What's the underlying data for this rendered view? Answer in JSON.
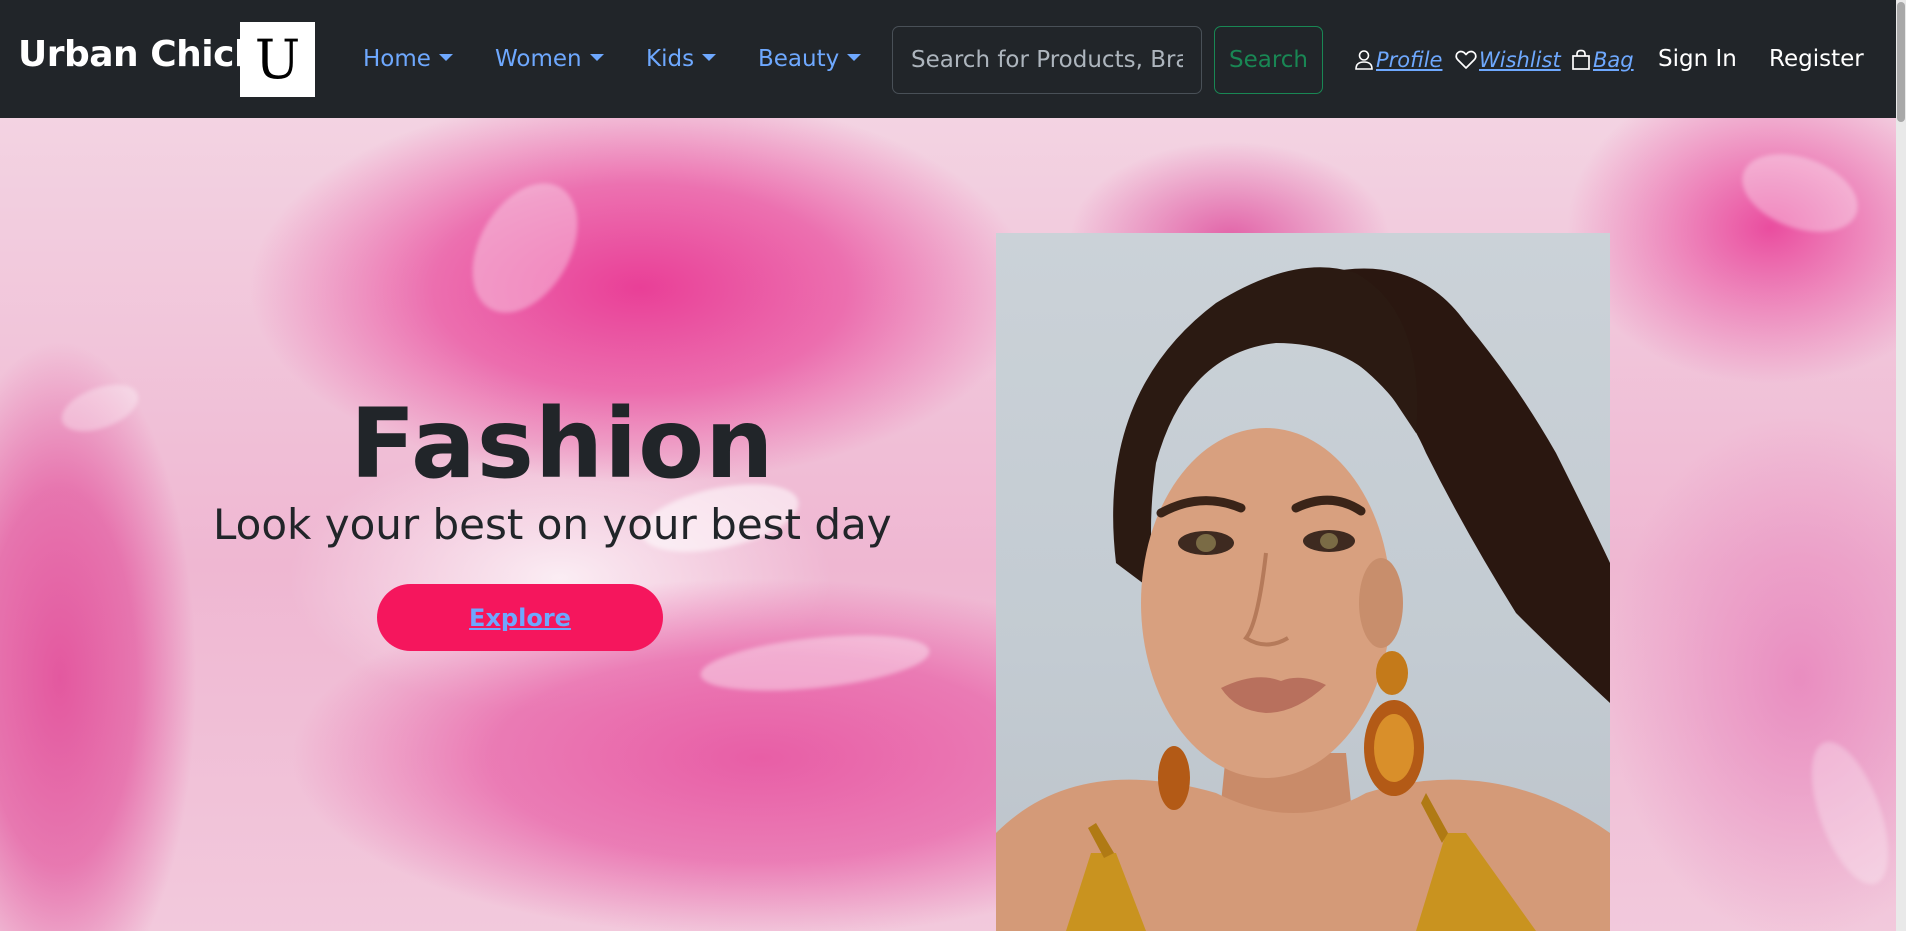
{
  "brand": {
    "name": "Urban Chick",
    "logo_letter": "U"
  },
  "nav": {
    "dropdowns": [
      "Home",
      "Women",
      "Kids",
      "Beauty"
    ],
    "search": {
      "placeholder": "Search for Products, Brands and More",
      "button": "Search"
    },
    "links": [
      {
        "label": "Profile",
        "icon": "person-icon"
      },
      {
        "label": "Wishlist",
        "icon": "heart-icon"
      },
      {
        "label": "Bag",
        "icon": "bag-icon"
      }
    ],
    "sign_in": "Sign In",
    "register": "Register"
  },
  "hero": {
    "title": "Fashion",
    "subtitle": "Look your best on your best day",
    "button": "Explore",
    "image_description": "model with dark ponytail and gold sequin outfit"
  },
  "colors": {
    "navbar": "#212529",
    "nav_link": "#6ea8fe",
    "search_button": "#198754",
    "explore_button": "#f5165d",
    "hero_background": "#f4c6dc"
  }
}
